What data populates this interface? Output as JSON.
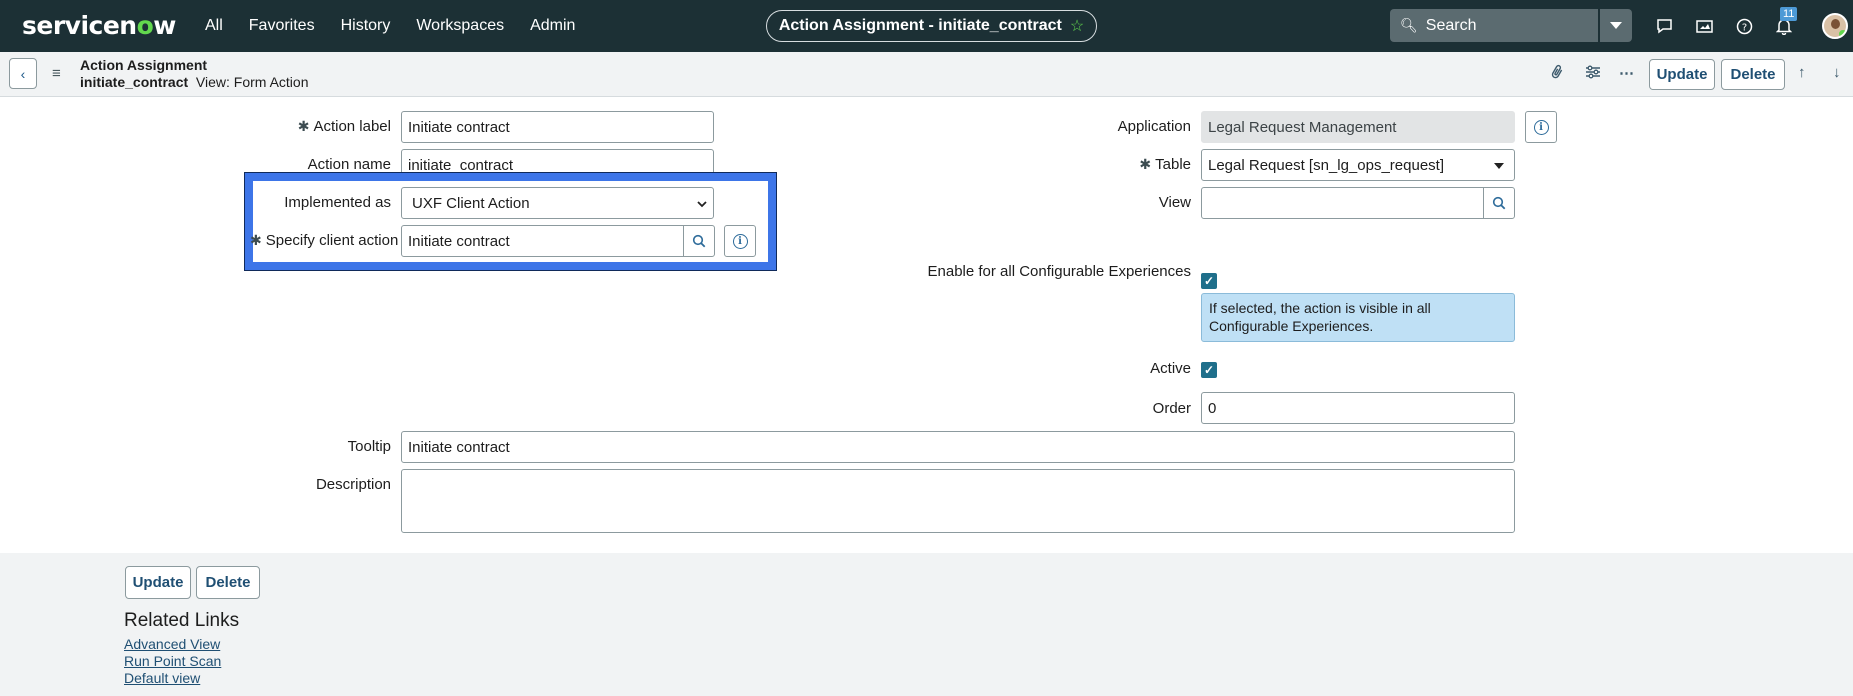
{
  "topnav": {
    "logo_pre": "servicen",
    "logo_o": "o",
    "logo_post": "w",
    "menu": [
      "All",
      "Favorites",
      "History",
      "Workspaces",
      "Admin"
    ],
    "title": "Action Assignment - initiate_contract",
    "search_placeholder": "Search",
    "notification_count": "11",
    "icons": [
      "chat-icon",
      "media-icon",
      "help-icon",
      "bell-icon"
    ]
  },
  "header": {
    "record_type": "Action Assignment",
    "record_name": "initiate_contract",
    "view_label": "View: Form Action",
    "update_label": "Update",
    "delete_label": "Delete"
  },
  "form": {
    "action_label": {
      "label": "Action label",
      "value": "Initiate contract"
    },
    "action_name": {
      "label": "Action name",
      "value": "initiate_contract"
    },
    "implemented_as": {
      "label": "Implemented as",
      "value": "UXF Client Action"
    },
    "client_action": {
      "label": "Specify client action",
      "value": "Initiate contract"
    },
    "application": {
      "label": "Application",
      "value": "Legal Request Management"
    },
    "table": {
      "label": "Table",
      "value": "Legal Request [sn_lg_ops_request]"
    },
    "view": {
      "label": "View",
      "value": ""
    },
    "enable_all": {
      "label": "Enable for all Configurable Experiences",
      "checked": true,
      "help": "If selected, the action is visible in all Configurable Experiences."
    },
    "active": {
      "label": "Active",
      "checked": true
    },
    "order": {
      "label": "Order",
      "value": "0"
    },
    "tooltip": {
      "label": "Tooltip",
      "value": "Initiate contract"
    },
    "description": {
      "label": "Description",
      "value": ""
    }
  },
  "bottom": {
    "update_label": "Update",
    "delete_label": "Delete",
    "related_links_title": "Related Links",
    "links": [
      "Advanced View",
      "Run Point Scan",
      "Default view"
    ]
  },
  "colors": {
    "nav_bg": "#1c3035",
    "logo_accent": "#62d84e",
    "highlight": "#3d75e8",
    "checkbox": "#1f6f8b",
    "help_bg": "#bfe0f5"
  }
}
